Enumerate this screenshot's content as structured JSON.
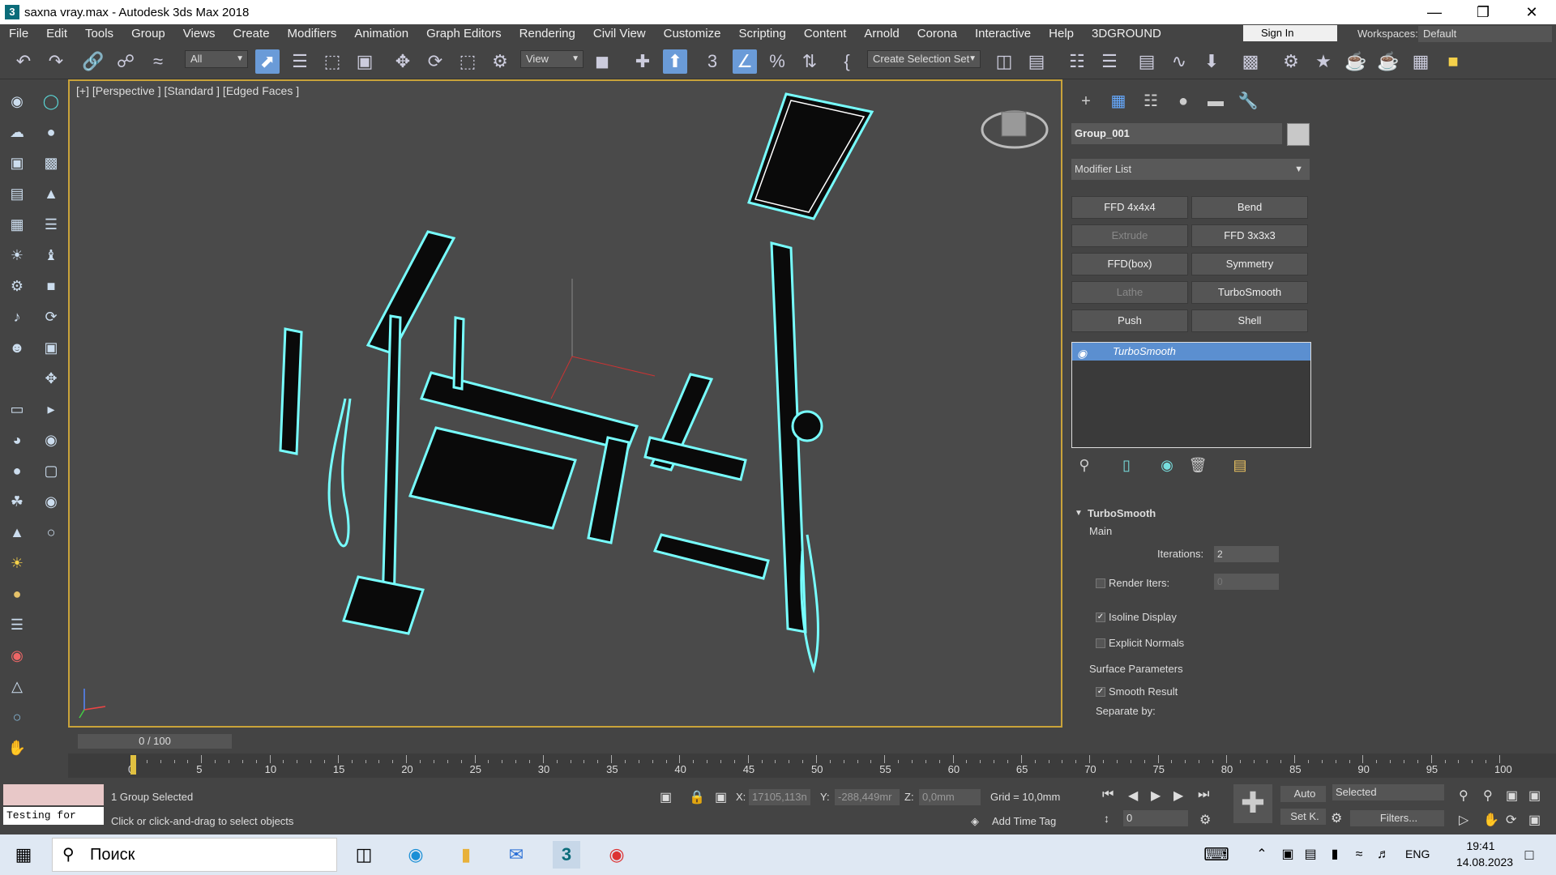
{
  "window": {
    "title": "saxna vray.max - Autodesk 3ds Max 2018",
    "app_icon": "3"
  },
  "menu": [
    "File",
    "Edit",
    "Tools",
    "Group",
    "Views",
    "Create",
    "Modifiers",
    "Animation",
    "Graph Editors",
    "Rendering",
    "Civil View",
    "Customize",
    "Scripting",
    "Content",
    "Arnold",
    "Corona",
    "Interactive",
    "Help",
    "3DGROUND"
  ],
  "signin": "Sign In",
  "workspaces": {
    "label": "Workspaces:",
    "value": "Default"
  },
  "toolbar": {
    "filter": "All",
    "refcoord": "View",
    "selset": "Create Selection Set"
  },
  "viewport": {
    "label": "[+] [Perspective ] [Standard ] [Edged Faces ]"
  },
  "panel": {
    "object_name": "Group_001",
    "modifier_list": "Modifier List",
    "buttons": [
      "FFD 4x4x4",
      "Bend",
      "Extrude",
      "FFD 3x3x3",
      "FFD(box)",
      "Symmetry",
      "Lathe",
      "TurboSmooth",
      "Push",
      "Shell"
    ],
    "stack_item": "TurboSmooth",
    "rollout": {
      "title": "TurboSmooth",
      "main": "Main",
      "iterations_label": "Iterations:",
      "iterations_value": "2",
      "render_iters_label": "Render Iters:",
      "render_iters_value": "0",
      "isoline": "Isoline Display",
      "explicit": "Explicit Normals",
      "surface": "Surface Parameters",
      "smooth_result": "Smooth Result",
      "separate_by": "Separate by:"
    }
  },
  "timeslider": {
    "value": "0 / 100"
  },
  "ruler": {
    "ticks": [
      "0",
      "5",
      "10",
      "15",
      "20",
      "25",
      "30",
      "35",
      "40",
      "45",
      "50",
      "55",
      "60",
      "65",
      "70",
      "75",
      "80",
      "85",
      "90",
      "95",
      "100"
    ]
  },
  "status": {
    "maxscript": "Testing for",
    "selected": "1 Group Selected",
    "prompt": "Click or click-and-drag to select objects",
    "x_label": "X:",
    "x_value": "17105,113n",
    "y_label": "Y:",
    "y_value": "-288,449mr",
    "z_label": "Z:",
    "z_value": "0,0mm",
    "grid": "Grid = 10,0mm",
    "add_time_tag": "Add Time Tag",
    "auto": "Auto",
    "set_key": "Set K.",
    "key_filter": "Selected",
    "filters": "Filters...",
    "frame": "0"
  },
  "taskbar": {
    "search": "Поиск",
    "lang": "ENG",
    "time": "19:41",
    "date": "14.08.2023"
  }
}
